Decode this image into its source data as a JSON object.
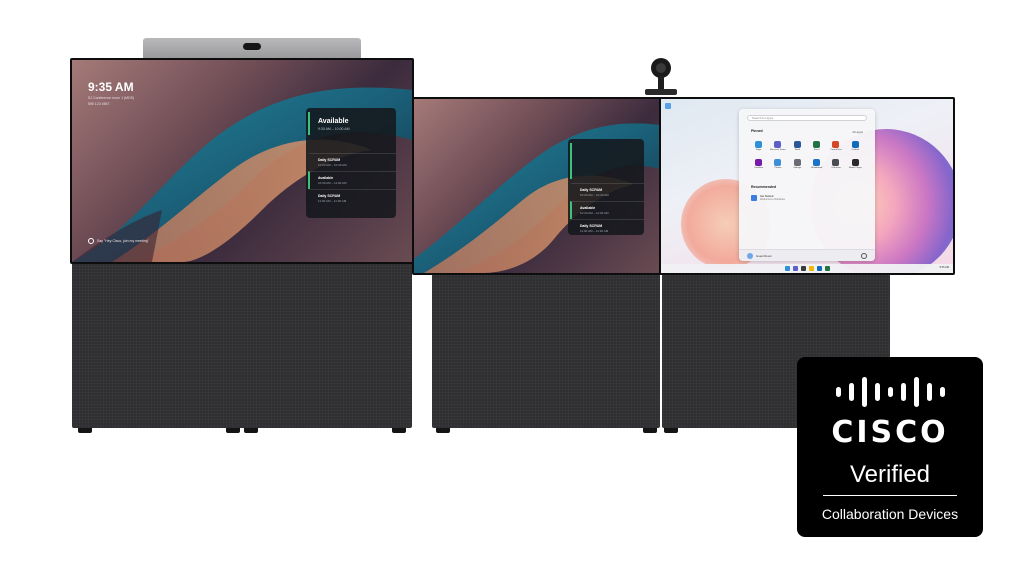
{
  "left_display": {
    "clock": {
      "time": "9:35 AM",
      "line1": "SJ Conference room 1 (MDS)",
      "line2": "555 123 4567"
    },
    "hint": "Say \"Hey Cisco, join my meeting\"",
    "panel": {
      "status": "Available",
      "status_sub": "9:30 AM – 10:00 AM",
      "items": [
        {
          "title": "Daily SCRUM",
          "sub": "10:00 AM – 10:30 AM",
          "accent": false
        },
        {
          "title": "Available",
          "sub": "10:30 AM – 11:00 AM",
          "accent": true
        },
        {
          "title": "Daily SCRUM",
          "sub": "11:00 AM – 11:30 AM",
          "accent": false
        }
      ]
    }
  },
  "middle_display": {
    "panel": {
      "status": "",
      "status_sub": "",
      "items": [
        {
          "title": "Daily SCRUM",
          "sub": "10:00 AM – 10:30 AM",
          "accent": false
        },
        {
          "title": "Available",
          "sub": "10:30 AM – 11:00 AM",
          "accent": true
        },
        {
          "title": "Daily SCRUM",
          "sub": "11:00 AM – 11:30 AM",
          "accent": false
        }
      ]
    }
  },
  "right_display": {
    "start_menu": {
      "search_placeholder": "Search for apps",
      "pinned_label": "Pinned",
      "all_apps_label": "All apps",
      "apps": [
        {
          "name": "Edge",
          "color": "#2f8fd8"
        },
        {
          "name": "Microsoft Teams",
          "color": "#5b5fc7"
        },
        {
          "name": "Word",
          "color": "#2b579a"
        },
        {
          "name": "Excel",
          "color": "#217346"
        },
        {
          "name": "PowerPoint",
          "color": "#d24726"
        },
        {
          "name": "Outlook",
          "color": "#0f6cbd"
        },
        {
          "name": "OneNote",
          "color": "#7719aa"
        },
        {
          "name": "Photos",
          "color": "#3b8ed8"
        },
        {
          "name": "Settings",
          "color": "#6b6b75"
        },
        {
          "name": "Whiteboard",
          "color": "#1a73c8"
        },
        {
          "name": "Calculator",
          "color": "#4a4a52"
        },
        {
          "name": "Media Player",
          "color": "#2a2a2a"
        }
      ],
      "recommended_label": "Recommended",
      "recommended_item": "Get Started",
      "recommended_sub": "Welcome to Windows",
      "user_name": "Guest Room"
    },
    "taskbar": {
      "icons": [
        "#2f8fd8",
        "#5b5fc7",
        "#3a3a3a",
        "#f2b705",
        "#0f6cbd",
        "#217346"
      ],
      "tray": "9:35 AM"
    }
  },
  "badge": {
    "wordmark": "CISCO",
    "verified": "Verified",
    "subtitle": "Collaboration Devices"
  }
}
